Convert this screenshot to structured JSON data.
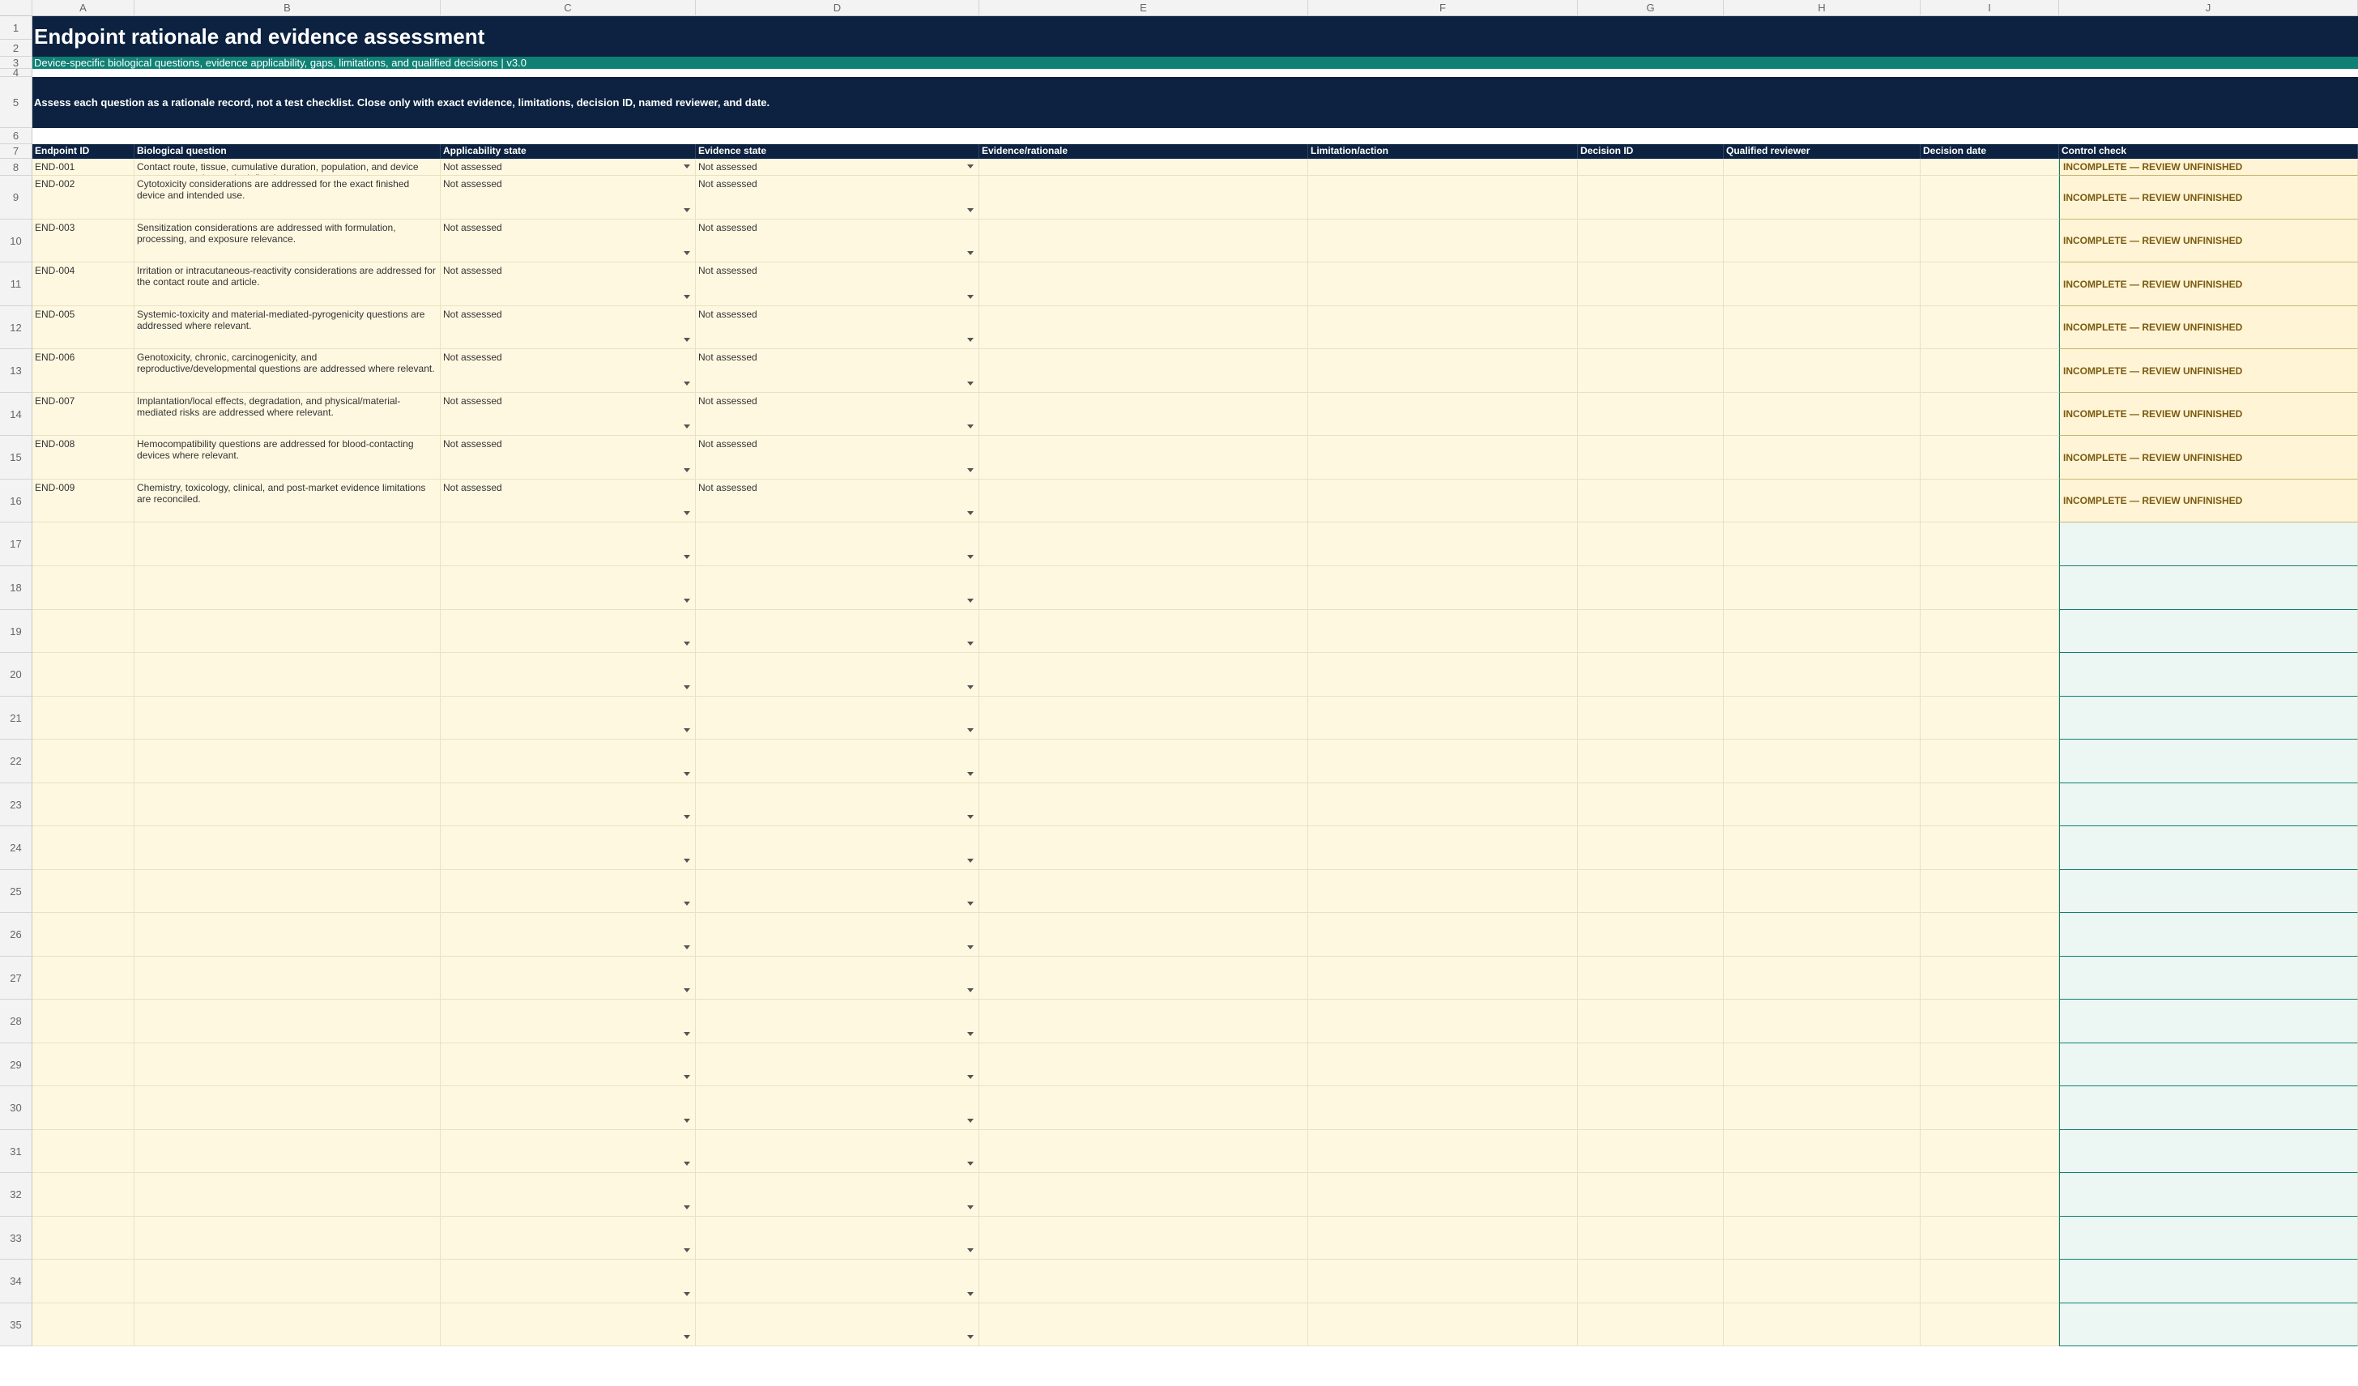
{
  "columns": [
    "A",
    "B",
    "C",
    "D",
    "E",
    "F",
    "G",
    "H",
    "I",
    "J"
  ],
  "row_numbers": [
    "1",
    "2",
    "3",
    "4",
    "5",
    "6",
    "7",
    "8",
    "9",
    "10",
    "11",
    "12",
    "13",
    "14",
    "15",
    "16",
    "17",
    "18",
    "19",
    "20",
    "21",
    "22",
    "23",
    "24",
    "25",
    "26",
    "27",
    "28",
    "29",
    "30",
    "31",
    "32",
    "33",
    "34",
    "35"
  ],
  "title": "Endpoint rationale and evidence assessment",
  "subtitle": "Device-specific biological questions, evidence applicability, gaps, limitations, and qualified decisions | v3.0",
  "instruction": "Assess each question as a rationale record, not a test checklist. Close only with exact evidence, limitations, decision ID, named reviewer, and date.",
  "headers": [
    "Endpoint ID",
    "Biological question",
    "Applicability state",
    "Evidence state",
    "Evidence/rationale",
    "Limitation/action",
    "Decision ID",
    "Qualified reviewer",
    "Decision date",
    "Control check"
  ],
  "rows": [
    {
      "id": "END-001",
      "question": "Contact route, tissue, cumulative duration, population, and device category are adequately defined.",
      "applicability": "Not assessed",
      "evidence": "Not assessed",
      "control": "INCOMPLETE — REVIEW UNFINISHED"
    },
    {
      "id": "END-002",
      "question": "Cytotoxicity considerations are addressed for the exact finished device and intended use.",
      "applicability": "Not assessed",
      "evidence": "Not assessed",
      "control": "INCOMPLETE — REVIEW UNFINISHED"
    },
    {
      "id": "END-003",
      "question": "Sensitization considerations are addressed with formulation, processing, and exposure relevance.",
      "applicability": "Not assessed",
      "evidence": "Not assessed",
      "control": "INCOMPLETE — REVIEW UNFINISHED"
    },
    {
      "id": "END-004",
      "question": "Irritation or intracutaneous-reactivity considerations are addressed for the contact route and article.",
      "applicability": "Not assessed",
      "evidence": "Not assessed",
      "control": "INCOMPLETE — REVIEW UNFINISHED"
    },
    {
      "id": "END-005",
      "question": "Systemic-toxicity and material-mediated-pyrogenicity questions are addressed where relevant.",
      "applicability": "Not assessed",
      "evidence": "Not assessed",
      "control": "INCOMPLETE — REVIEW UNFINISHED"
    },
    {
      "id": "END-006",
      "question": "Genotoxicity, chronic, carcinogenicity, and reproductive/developmental questions are addressed where relevant.",
      "applicability": "Not assessed",
      "evidence": "Not assessed",
      "control": "INCOMPLETE — REVIEW UNFINISHED"
    },
    {
      "id": "END-007",
      "question": "Implantation/local effects, degradation, and physical/material-mediated risks are addressed where relevant.",
      "applicability": "Not assessed",
      "evidence": "Not assessed",
      "control": "INCOMPLETE — REVIEW UNFINISHED"
    },
    {
      "id": "END-008",
      "question": "Hemocompatibility questions are addressed for blood-contacting devices where relevant.",
      "applicability": "Not assessed",
      "evidence": "Not assessed",
      "control": "INCOMPLETE — REVIEW UNFINISHED"
    },
    {
      "id": "END-009",
      "question": "Chemistry, toxicology, clinical, and post-market evidence limitations are reconciled.",
      "applicability": "Not assessed",
      "evidence": "Not assessed",
      "control": "INCOMPLETE — REVIEW UNFINISHED"
    }
  ],
  "empty_row_count": 19,
  "colors": {
    "navy": "#0c2240",
    "teal": "#0e8074",
    "cell_fill": "#fff8e1",
    "control_fill": "#ecf6f2",
    "warning_text": "#7a5a0e"
  }
}
